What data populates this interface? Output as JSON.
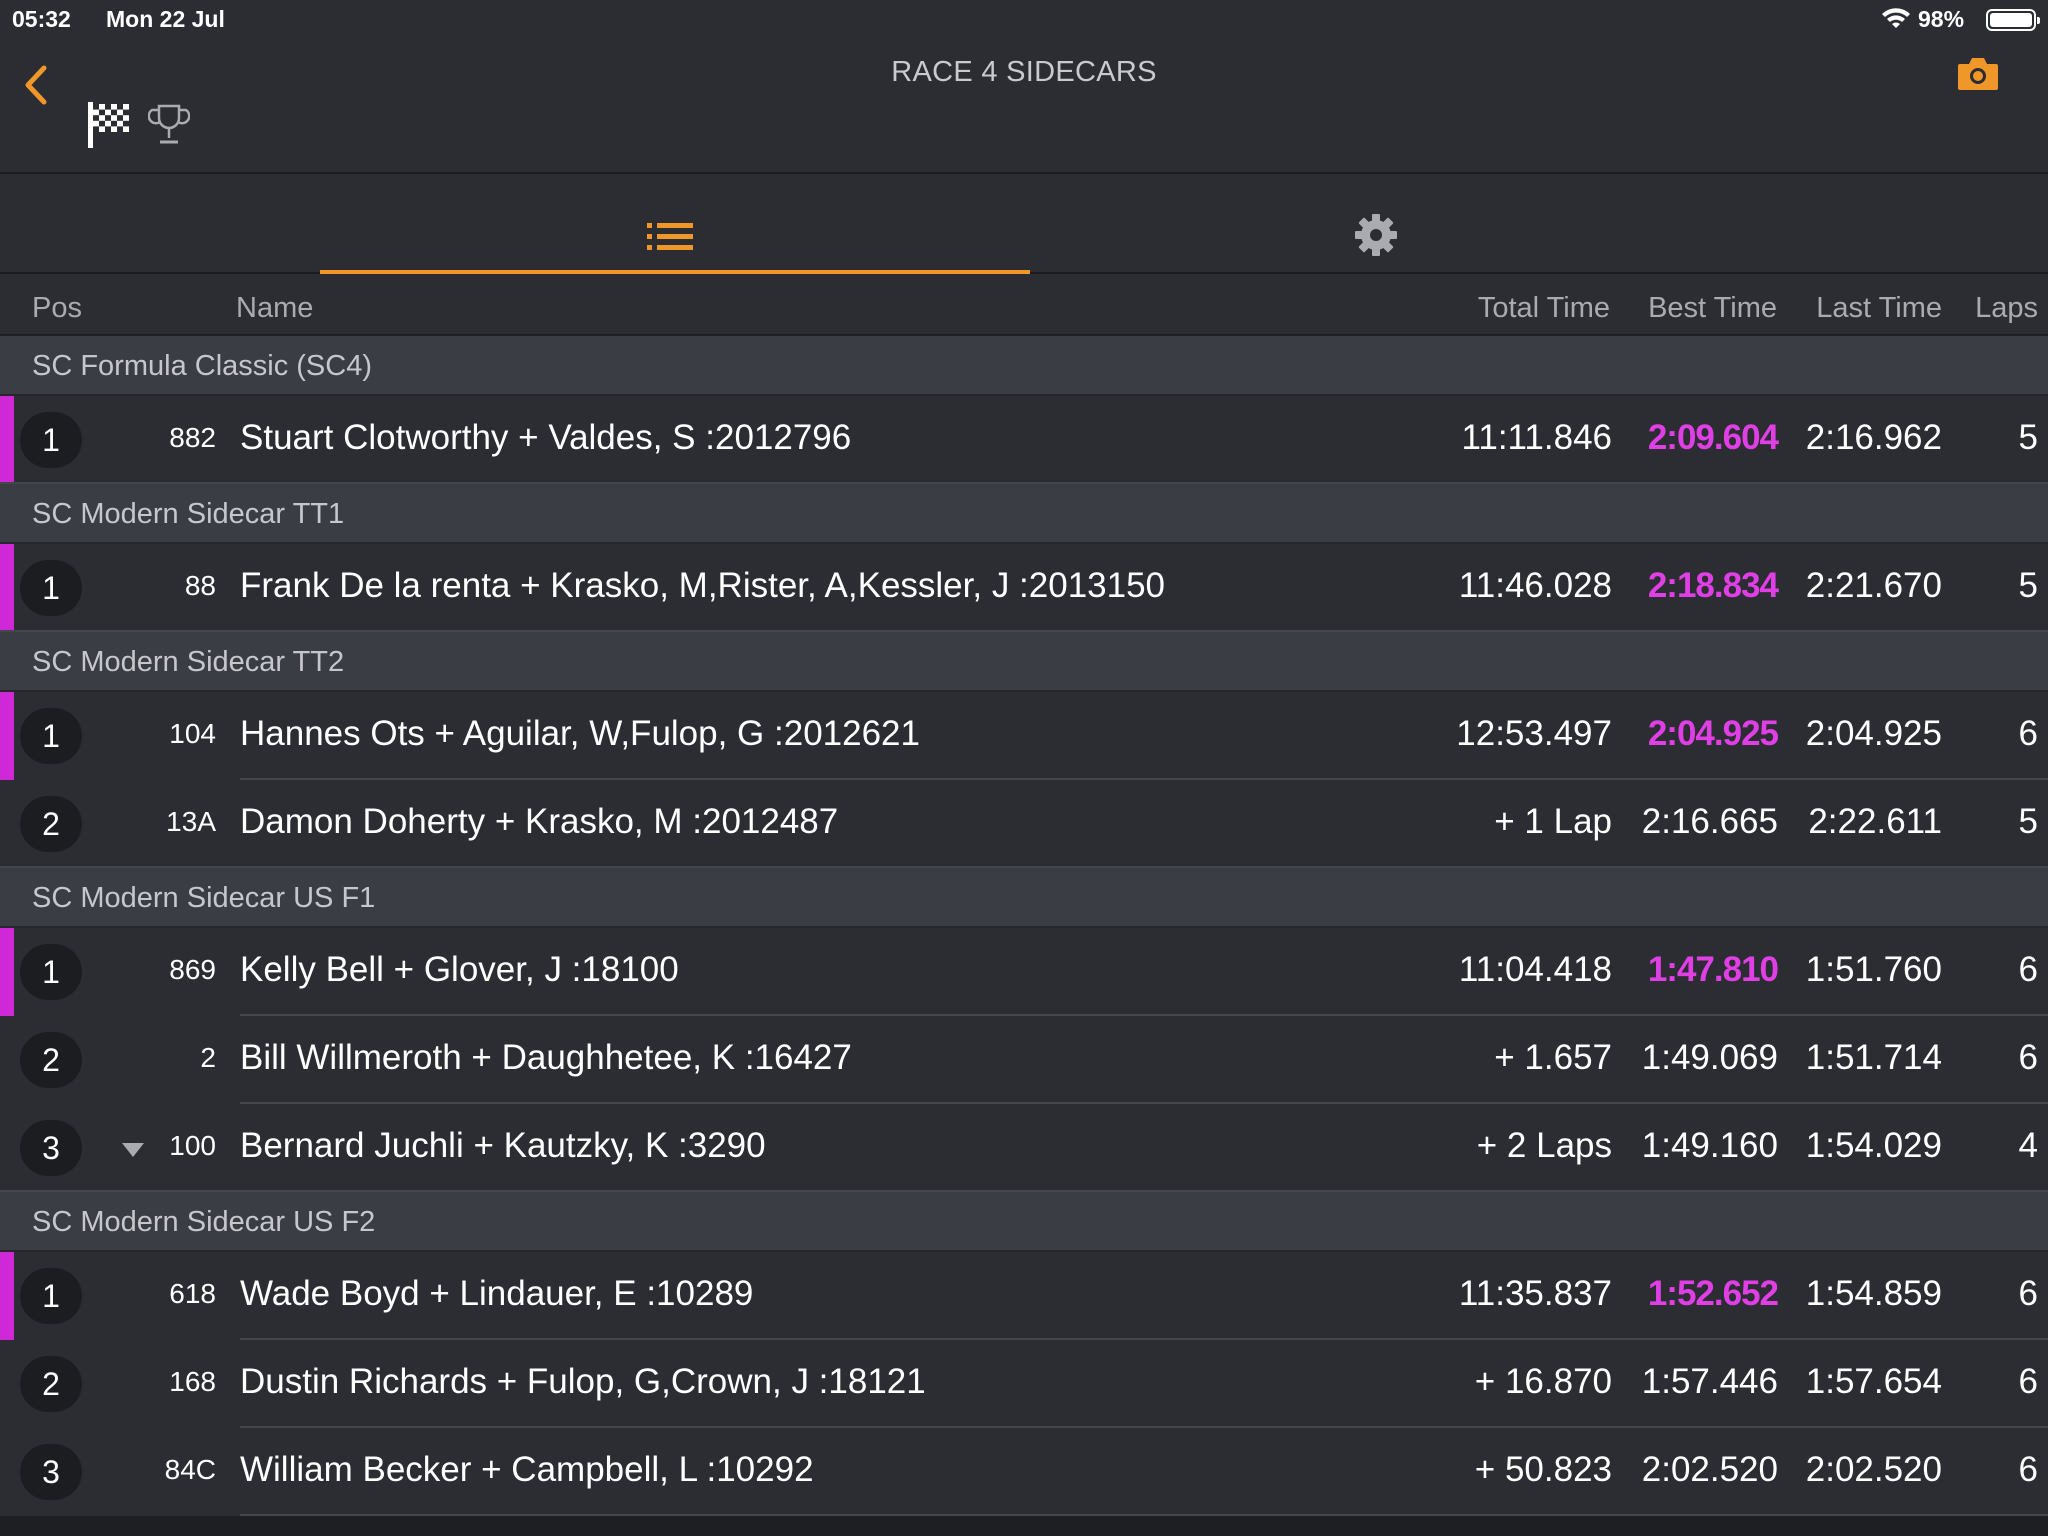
{
  "status_bar": {
    "time": "05:32",
    "date": "Mon 22 Jul",
    "battery": "98%"
  },
  "header": {
    "title": "RACE 4 SIDECARS"
  },
  "columns": {
    "pos": "Pos",
    "name": "Name",
    "total_time": "Total Time",
    "best_time": "Best Time",
    "last_time": "Last Time",
    "laps": "Laps"
  },
  "colors": {
    "accent": "#f0972a",
    "fastest": "#e03fe5",
    "background": "#2b2d33",
    "class_header": "#3b3d44"
  },
  "classes": [
    {
      "name": "SC Formula Classic (SC4)",
      "rows": [
        {
          "pos": "1",
          "bib": "882",
          "name": "Stuart Clotworthy + Valdes, S :2012796",
          "total": "11:11.846",
          "best": "2:09.604",
          "last": "2:16.962",
          "laps": "5"
        }
      ]
    },
    {
      "name": "SC Modern Sidecar TT1",
      "rows": [
        {
          "pos": "1",
          "bib": "88",
          "name": "Frank De la renta + Krasko, M,Rister, A,Kessler, J :2013150",
          "total": "11:46.028",
          "best": "2:18.834",
          "last": "2:21.670",
          "laps": "5"
        }
      ]
    },
    {
      "name": "SC Modern Sidecar TT2",
      "rows": [
        {
          "pos": "1",
          "bib": "104",
          "name": "Hannes Ots + Aguilar, W,Fulop, G :2012621",
          "total": "12:53.497",
          "best": "2:04.925",
          "last": "2:04.925",
          "laps": "6"
        },
        {
          "pos": "2",
          "bib": "13A",
          "name": "Damon Doherty + Krasko, M :2012487",
          "total": "+ 1 Lap",
          "best": "2:16.665",
          "last": "2:22.611",
          "laps": "5"
        }
      ]
    },
    {
      "name": "SC Modern Sidecar US F1",
      "rows": [
        {
          "pos": "1",
          "bib": "869",
          "name": "Kelly Bell + Glover, J :18100",
          "total": "11:04.418",
          "best": "1:47.810",
          "last": "1:51.760",
          "laps": "6"
        },
        {
          "pos": "2",
          "bib": "2",
          "name": "Bill Willmeroth + Daughhetee, K :16427",
          "total": "+ 1.657",
          "best": "1:49.069",
          "last": "1:51.714",
          "laps": "6"
        },
        {
          "pos": "3",
          "bib": "100",
          "name": "Bernard Juchli + Kautzky, K :3290",
          "total": "+ 2 Laps",
          "best": "1:49.160",
          "last": "1:54.029",
          "laps": "4"
        }
      ]
    },
    {
      "name": "SC Modern Sidecar US F2",
      "rows": [
        {
          "pos": "1",
          "bib": "618",
          "name": "Wade Boyd + Lindauer, E :10289",
          "total": "11:35.837",
          "best": "1:52.652",
          "last": "1:54.859",
          "laps": "6"
        },
        {
          "pos": "2",
          "bib": "168",
          "name": "Dustin Richards + Fulop, G,Crown, J :18121",
          "total": "+ 16.870",
          "best": "1:57.446",
          "last": "1:57.654",
          "laps": "6"
        },
        {
          "pos": "3",
          "bib": "84C",
          "name": "William Becker + Campbell, L :10292",
          "total": "+ 50.823",
          "best": "2:02.520",
          "last": "2:02.520",
          "laps": "6"
        }
      ]
    }
  ]
}
